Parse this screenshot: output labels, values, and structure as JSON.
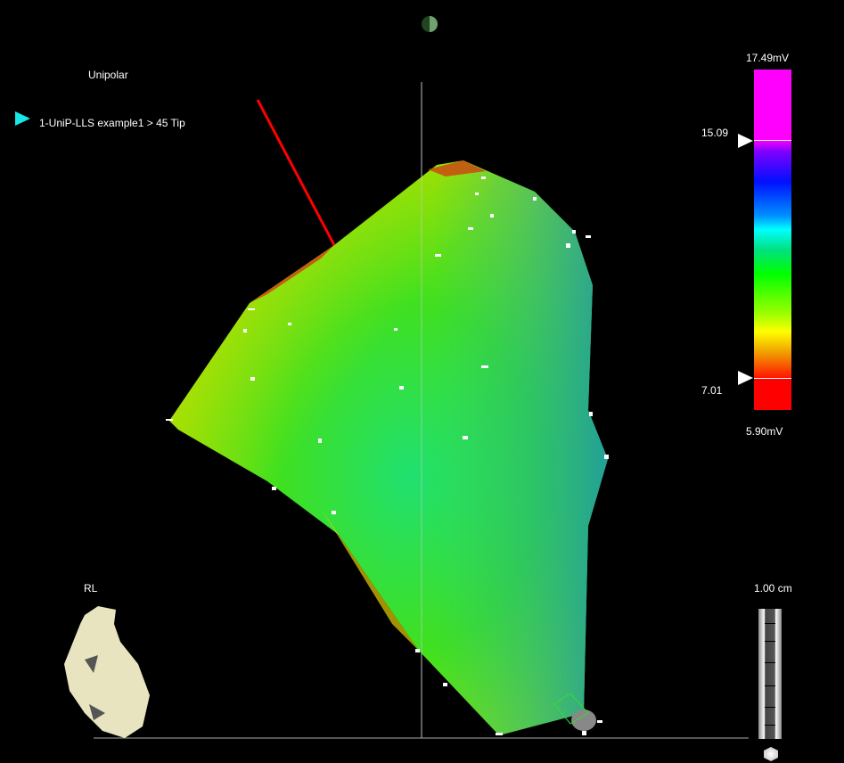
{
  "map": {
    "title": "Unipolar",
    "map_name": "1-UniP-LLS example1 > 45 Tip",
    "view_label": "RL",
    "map_indicator_icon": "triangle-right-icon",
    "map_indicator_color": "#19e6e6"
  },
  "color_bar": {
    "max_label": "17.49mV",
    "min_label": "5.90mV",
    "upper_threshold": "15.09",
    "lower_threshold": "7.01"
  },
  "scale": {
    "label": "1.00 cm"
  },
  "colors": {
    "catheter": "#ff0000",
    "background": "#000000"
  }
}
